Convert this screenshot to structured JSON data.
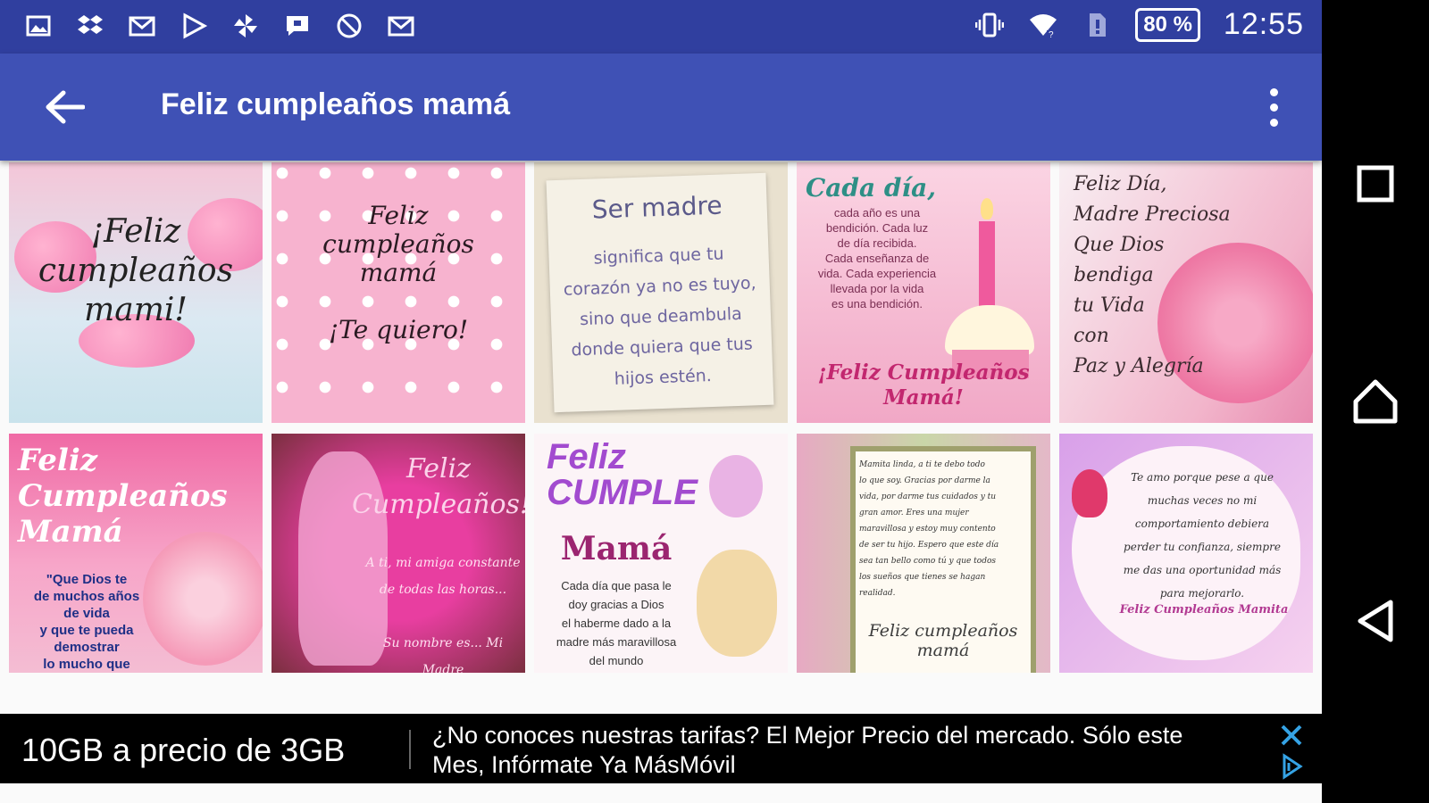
{
  "status_bar": {
    "notification_icons": [
      "gallery-icon",
      "dropbox-icon",
      "gmail-icon",
      "play-store-icon",
      "pinwheel-icon",
      "chat-icon",
      "no-location-icon",
      "email-icon"
    ],
    "battery_label": "80 %",
    "time": "12:55"
  },
  "app_bar": {
    "title": "Feliz cumpleaños mamá",
    "back_icon": "arrow-back-icon",
    "menu_icon": "more-vert-icon"
  },
  "gallery": {
    "items": [
      {
        "caption": "¡Feliz\ncumpleaños\nmami!"
      },
      {
        "caption": "Feliz\ncumpleaños\nmamá\n\n¡Te quiero!"
      },
      {
        "heading": "Ser madre",
        "caption": "significa que tu\ncorazón ya no es tuyo,\nsino que deambula\ndonde quiera que tus\nhijos estén."
      },
      {
        "heading": "Cada día,",
        "caption": "cada año es una\nbendición. Cada luz\nde día recibida.\nCada enseñanza de\nvida. Cada experiencia\nllevada por la vida\nes una bendición.",
        "footer": "¡Feliz Cumpleaños\nMamá!"
      },
      {
        "caption": "Feliz Día,\nMadre Preciosa\nQue Dios\nbendiga\ntu Vida\ncon\nPaz y Alegría"
      },
      {
        "heading": "Feliz\nCumpleaños\nMamá",
        "caption": "\"Que Dios te\nde muchos años\nde vida\ny que te pueda\ndemostrar\nlo mucho que"
      },
      {
        "heading": "Feliz\nCumpleaños!",
        "caption": "A ti, mi amiga constante\nde todas las horas...\n\nSu nombre es... Mi Madre"
      },
      {
        "heading": "Feliz\nCUMPLE",
        "name": "Mamá",
        "caption": "Cada día que pasa le\ndoy gracias a Dios\nel haberme dado a la\nmadre más maravillosa\ndel mundo"
      },
      {
        "caption": "Mamita linda, a ti te debo todo\nlo que soy. Gracias por darme la\nvida, por darme tus cuidados y tu\ngran amor. Eres una mujer\nmaravillosa y estoy muy contento\nde ser tu hijo. Espero que este día\nsea tan bello como tú y que todos\nlos sueños que tienes se hagan\nrealidad.",
        "footer": "Feliz cumpleaños\nmamá"
      },
      {
        "caption": "Te amo porque pese a que\nmuchas veces no mi\ncomportamiento debiera\nperder tu confianza, siempre\nme das una oportunidad más\npara mejorarlo.",
        "footer": "Feliz Cumpleaños Mamita"
      }
    ]
  },
  "ad": {
    "headline": "10GB a precio de 3GB",
    "body": "¿No conoces nuestras tarifas? El Mejor Precio del mercado. Sólo este Mes, Infórmate Ya MásMóvil",
    "close_icon": "close-icon",
    "adchoices_icon": "adchoices-icon"
  },
  "nav_bar": {
    "buttons": [
      "recents-square-icon",
      "home-icon",
      "back-triangle-icon"
    ]
  }
}
